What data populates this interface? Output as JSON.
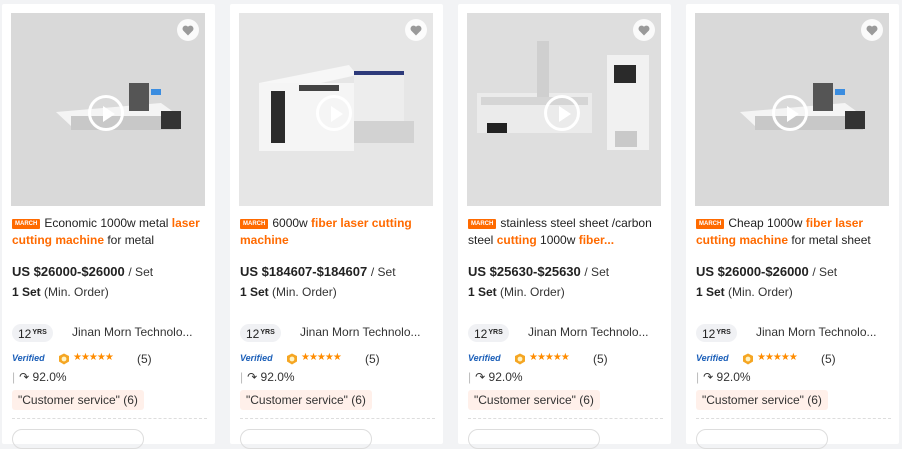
{
  "colors": {
    "accent": "#ff6a00",
    "verified": "#1a5eb8",
    "tag_bg": "#fff0ea"
  },
  "products": [
    {
      "badge": "MARCH",
      "title_parts": [
        {
          "text": "Economic 1000w metal ",
          "hl": false
        },
        {
          "text": "laser cutting machine",
          "hl": true
        },
        {
          "text": " for metal",
          "hl": false
        }
      ],
      "price": "US $26000-$26000",
      "unit": "/ Set",
      "moq_value": "1 Set",
      "moq_label": "(Min. Order)",
      "years": "12",
      "years_unit": "YRS",
      "company": "Jinan Morn Technolo...",
      "verified": "Verified",
      "stars": "★★★★★",
      "rating_count": "(5)",
      "response": "92.0%",
      "tag": "\"Customer service\" (6)"
    },
    {
      "badge": "MARCH",
      "title_parts": [
        {
          "text": "6000w ",
          "hl": false
        },
        {
          "text": "fiber laser cutting machine",
          "hl": true
        }
      ],
      "price": "US $184607-$184607",
      "unit": "/ Set",
      "moq_value": "1 Set",
      "moq_label": "(Min. Order)",
      "years": "12",
      "years_unit": "YRS",
      "company": "Jinan Morn Technolo...",
      "verified": "Verified",
      "stars": "★★★★★",
      "rating_count": "(5)",
      "response": "92.0%",
      "tag": "\"Customer service\" (6)"
    },
    {
      "badge": "MARCH",
      "title_parts": [
        {
          "text": "stainless steel sheet /carbon steel ",
          "hl": false
        },
        {
          "text": "cutting",
          "hl": true
        },
        {
          "text": " 1000w ",
          "hl": false
        },
        {
          "text": "fiber...",
          "hl": true
        }
      ],
      "price": "US $25630-$25630",
      "unit": "/ Set",
      "moq_value": "1 Set",
      "moq_label": "(Min. Order)",
      "years": "12",
      "years_unit": "YRS",
      "company": "Jinan Morn Technolo...",
      "verified": "Verified",
      "stars": "★★★★★",
      "rating_count": "(5)",
      "response": "92.0%",
      "tag": "\"Customer service\" (6)"
    },
    {
      "badge": "MARCH",
      "title_parts": [
        {
          "text": "Cheap 1000w ",
          "hl": false
        },
        {
          "text": "fiber laser cutting machine",
          "hl": true
        },
        {
          "text": " for metal sheet",
          "hl": false
        }
      ],
      "price": "US $26000-$26000",
      "unit": "/ Set",
      "moq_value": "1 Set",
      "moq_label": "(Min. Order)",
      "years": "12",
      "years_unit": "YRS",
      "company": "Jinan Morn Technolo...",
      "verified": "Verified",
      "stars": "★★★★★",
      "rating_count": "(5)",
      "response": "92.0%",
      "tag": "\"Customer service\" (6)"
    }
  ]
}
